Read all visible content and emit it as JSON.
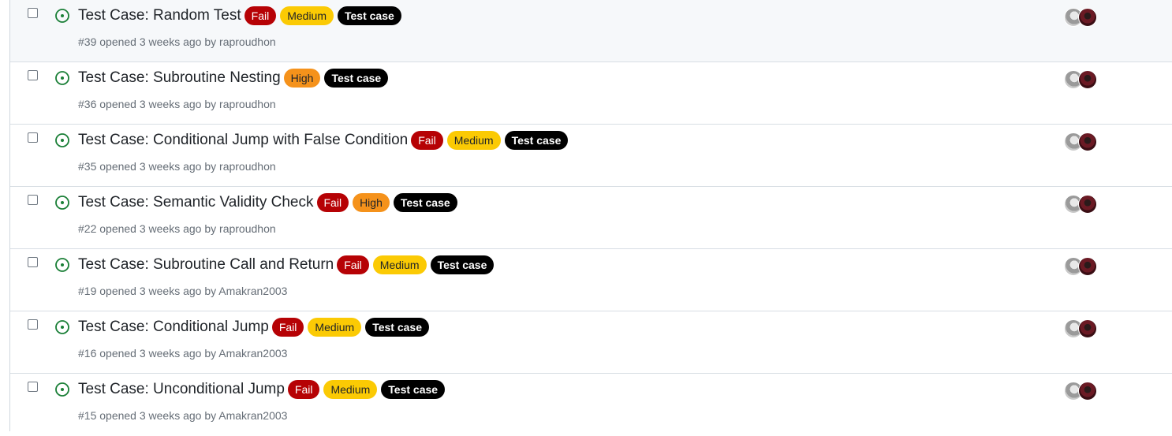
{
  "issues": [
    {
      "title": "Test Case: Random Test",
      "labels": [
        {
          "text": "Fail",
          "kind": "fail"
        },
        {
          "text": "Medium",
          "kind": "medium"
        },
        {
          "text": "Test case",
          "kind": "testcase"
        }
      ],
      "meta_prefix": "#39 opened 3 weeks ago by",
      "author": "raproudhon",
      "hovered": true
    },
    {
      "title": "Test Case: Subroutine Nesting",
      "labels": [
        {
          "text": "High",
          "kind": "high"
        },
        {
          "text": "Test case",
          "kind": "testcase"
        }
      ],
      "meta_prefix": "#36 opened 3 weeks ago by",
      "author": "raproudhon",
      "hovered": false
    },
    {
      "title": "Test Case: Conditional Jump with False Condition",
      "labels": [
        {
          "text": "Fail",
          "kind": "fail"
        },
        {
          "text": "Medium",
          "kind": "medium"
        },
        {
          "text": "Test case",
          "kind": "testcase"
        }
      ],
      "meta_prefix": "#35 opened 3 weeks ago by",
      "author": "raproudhon",
      "hovered": false
    },
    {
      "title": "Test Case: Semantic Validity Check",
      "labels": [
        {
          "text": "Fail",
          "kind": "fail"
        },
        {
          "text": "High",
          "kind": "high"
        },
        {
          "text": "Test case",
          "kind": "testcase"
        }
      ],
      "meta_prefix": "#22 opened 3 weeks ago by",
      "author": "raproudhon",
      "hovered": false
    },
    {
      "title": "Test Case: Subroutine Call and Return",
      "labels": [
        {
          "text": "Fail",
          "kind": "fail"
        },
        {
          "text": "Medium",
          "kind": "medium"
        },
        {
          "text": "Test case",
          "kind": "testcase"
        }
      ],
      "meta_prefix": "#19 opened 3 weeks ago by",
      "author": "Amakran2003",
      "hovered": false
    },
    {
      "title": "Test Case: Conditional Jump",
      "labels": [
        {
          "text": "Fail",
          "kind": "fail"
        },
        {
          "text": "Medium",
          "kind": "medium"
        },
        {
          "text": "Test case",
          "kind": "testcase"
        }
      ],
      "meta_prefix": "#16 opened 3 weeks ago by",
      "author": "Amakran2003",
      "hovered": false
    },
    {
      "title": "Test Case: Unconditional Jump",
      "labels": [
        {
          "text": "Fail",
          "kind": "fail"
        },
        {
          "text": "Medium",
          "kind": "medium"
        },
        {
          "text": "Test case",
          "kind": "testcase"
        }
      ],
      "meta_prefix": "#15 opened 3 weeks ago by",
      "author": "Amakran2003",
      "hovered": false
    }
  ],
  "icons": {
    "status": "issue-opened-icon",
    "assignees": "assignee-avatars"
  },
  "colors": {
    "open_icon": "#1a7f37",
    "fail": "#b60205",
    "medium": "#fbca04",
    "high": "#f5921b",
    "testcase": "#000000"
  }
}
